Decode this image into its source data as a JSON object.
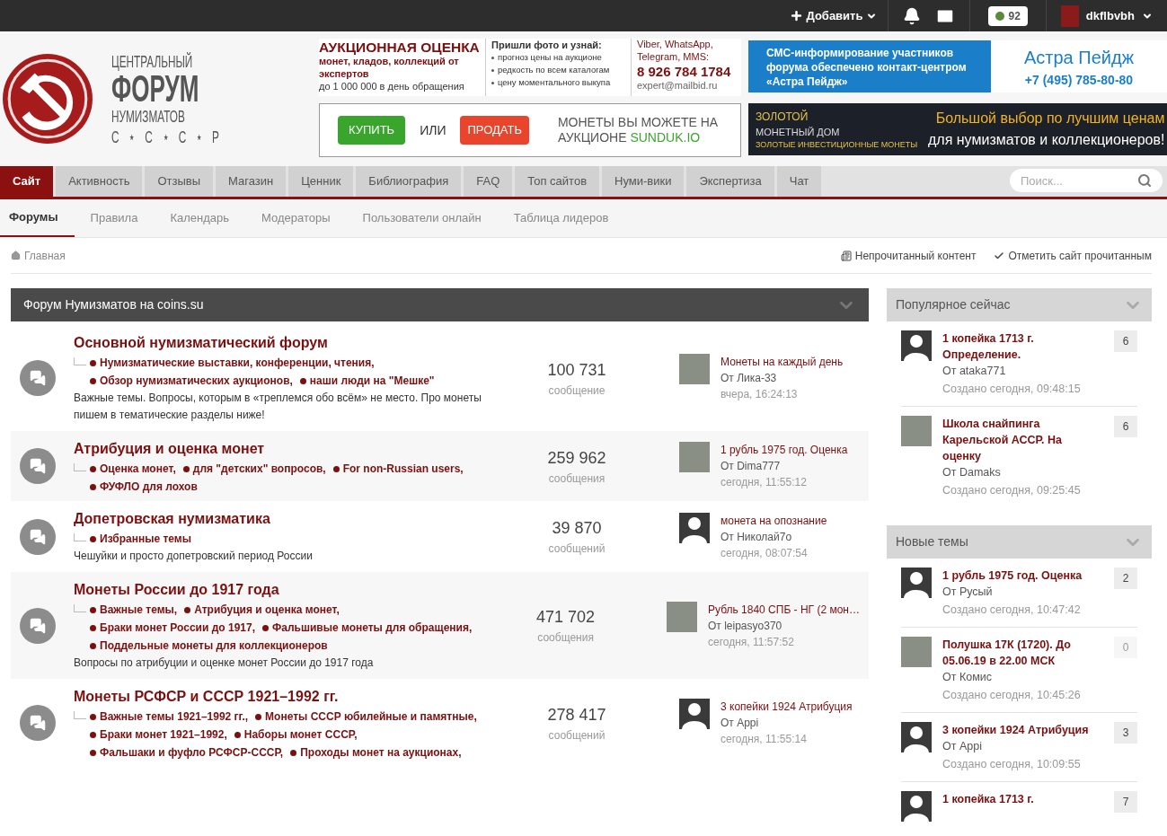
{
  "topbar": {
    "add": "Добавить",
    "points": "92",
    "user": "dkflbvbh"
  },
  "logo": {
    "line1": "ЦЕНТРАЛЬНЫЙ",
    "line2": "ФОРУМ",
    "line3": "НУМИЗМАТОВ",
    "line4": "С ⋆ С ⋆ С ⋆ Р"
  },
  "ad_appraisal": {
    "title": "АУКЦИОННАЯ ОЦЕНКА",
    "subtitle": "монет, кладов, коллекций от экспертов",
    "note": "до 1 000 000 в день обращения",
    "heading": "Пришли фото и узнай:",
    "bullets": [
      "прогноз цены на аукционе",
      "редкость по всем каталогам",
      "цену моментального выкупа"
    ],
    "contacts": "Viber, WhatsApp, Telegram, MMS:",
    "phone": "8 926 784 1784",
    "email": "expert@mailbid.ru"
  },
  "ad_sms": {
    "text": "СМС-информирование участников форума обеспечено контакт-центром «Астра Пейдж»",
    "brand": "Астра Пейдж",
    "phone": "+7 (495) 785-80-80"
  },
  "ad_sunduk": {
    "buy": "КУПИТЬ",
    "or": "ИЛИ",
    "sell": "ПРОДАТЬ",
    "text": "МОНЕТЫ ВЫ МОЖЕТЕ НА АУКЦИОНЕ",
    "brand": "SUNDUK.IO"
  },
  "ad_coinhouse": {
    "brand1": "ЗОЛОТОЙ",
    "brand2": "МОНЕТНЫЙ ДОМ",
    "brand3": "ЗОЛОТЫЕ ИНВЕСТИЦИОННЫЕ МОНЕТЫ",
    "line1": "Большой выбор по лучшим ценам",
    "line2": "для нумизматов и коллекционеров!"
  },
  "tabs": [
    {
      "label": "Сайт",
      "selected": true
    },
    {
      "label": "Активность",
      "selected": false
    },
    {
      "label": "Отзывы",
      "selected": false
    },
    {
      "label": "Магазин",
      "selected": false
    },
    {
      "label": "Ценник",
      "selected": false
    },
    {
      "label": "Библиография",
      "selected": false
    },
    {
      "label": "FAQ",
      "selected": false
    },
    {
      "label": "Топ сайтов",
      "selected": false
    },
    {
      "label": "Нуми-вики",
      "selected": false
    },
    {
      "label": "Экспертиза",
      "selected": false
    },
    {
      "label": "Чат",
      "selected": false
    }
  ],
  "search": {
    "placeholder": "Поиск..."
  },
  "subnav": [
    {
      "label": "Форумы",
      "selected": true
    },
    {
      "label": "Правила",
      "selected": false
    },
    {
      "label": "Календарь",
      "selected": false
    },
    {
      "label": "Модераторы",
      "selected": false
    },
    {
      "label": "Пользователи онлайн",
      "selected": false
    },
    {
      "label": "Таблица лидеров",
      "selected": false
    }
  ],
  "breadcrumb": "Главная",
  "unread": "Непрочитанный контент",
  "mark_read": "Отметить сайт прочитанным",
  "category": {
    "title": "Форум Нумизматов на coins.su",
    "forums": [
      {
        "title": "Основной нумизматический форум",
        "subforums": [
          "Нумизматические выставки, конференции, чтения,",
          "Обзор нумизматических аукционов,",
          "наши люди на \"Мешке\""
        ],
        "description": "Важные темы. Вопросы, которым в «треплемся обо всём» не место. Про монеты пишем в тематические разделы ниже!",
        "count": "100 731",
        "count_label": "сообщение",
        "last": {
          "avatar": {
            "kind": "photo"
          },
          "topic": "Монеты на каждый день",
          "author": "От Лика-33",
          "time": "вчера, 16:24:13"
        }
      },
      {
        "title": "Атрибуция и оценка монет",
        "subforums": [
          "Оценка монет,",
          "для \"детских\" вопросов,",
          "For non-Russian users,",
          "ФУФЛО для лохов"
        ],
        "count": "259 962",
        "count_label": "сообщения",
        "last": {
          "avatar": {
            "kind": "photo"
          },
          "topic": "1 рубль 1975 год. Оценка",
          "author": "От Dima777",
          "time": "сегодня, 11:55:12"
        }
      },
      {
        "title": "Допетровская нумизматика",
        "subforums": [
          "Избранные темы"
        ],
        "description": "Чешуйки и просто допетровский период России",
        "count": "39 870",
        "count_label": "сообщений",
        "last": {
          "avatar": {
            "kind": "default"
          },
          "topic": "монета на опознание",
          "author": "От Николай7о",
          "time": "сегодня, 08:07:54"
        }
      },
      {
        "title": "Монеты России до 1917 года",
        "subforums": [
          "Важные темы,",
          "Атрибуция и оценка монет,",
          "Браки монет России до 1917,",
          "Фальшивые монеты для обращения,",
          "Поддельные монеты для коллекционеров"
        ],
        "description": "Вопросы по атрибуции и оценке монет России до 1917 года",
        "count": "471 702",
        "count_label": "сообщения",
        "last": {
          "avatar": {
            "kind": "photo"
          },
          "topic": "Рубль 1840 СПБ - НГ (2 мон…",
          "author": "От leipasyo370",
          "time": "сегодня, 11:57:52"
        }
      },
      {
        "title": "Монеты РСФСР и СССР 1921–1992 гг.",
        "subforums": [
          "Важные темы 1921–1992 гг.,",
          "Монеты СССР юбилейные и памятные,",
          "Браки монет 1921–1992,",
          "Наборы монет СССР,",
          "Фальшаки и фуфло РСФСР-СССР,",
          "Проходы монет на аукционах,"
        ],
        "count": "278 417",
        "count_label": "сообщений",
        "last": {
          "avatar": {
            "kind": "default"
          },
          "topic": "3 копейки 1924 Атрибуция",
          "author": "От Appi",
          "time": "сегодня, 11:55:14"
        }
      }
    ]
  },
  "sidebar": [
    {
      "title": "Популярное сейчас",
      "items": [
        {
          "avatar": {
            "kind": "default"
          },
          "topic": "1 копейка 1713 г. Определение.",
          "author": "От ataka771",
          "time": "Создано сегодня, 09:48:15",
          "count": "6",
          "dim": false
        },
        {
          "avatar": {
            "kind": "photo"
          },
          "topic": "Школа снайпинга Карельской АССР. На оценку",
          "author": "От Damaks",
          "time": "Создано сегодня, 09:25:45",
          "count": "6",
          "dim": false
        }
      ]
    },
    {
      "title": "Новые темы",
      "items": [
        {
          "avatar": {
            "kind": "default"
          },
          "topic": "1 рубль 1975 год. Оценка",
          "author": "От Русый",
          "time": "Создано сегодня, 10:47:42",
          "count": "2",
          "dim": false
        },
        {
          "avatar": {
            "kind": "photo"
          },
          "topic": "Полушка 17К (1720). До 05.06.19 в 22.00 МСК",
          "author": "От Комис",
          "time": "Создано сегодня, 10:45:26",
          "count": "0",
          "dim": true
        },
        {
          "avatar": {
            "kind": "default"
          },
          "topic": "3 копейки 1924 Атрибуция",
          "author": "От Appi",
          "time": "Создано сегодня, 10:09:55",
          "count": "3",
          "dim": false
        },
        {
          "avatar": {
            "kind": "default"
          },
          "topic": "1 копейка 1713 г.",
          "count": "7",
          "dim": false
        }
      ]
    }
  ]
}
